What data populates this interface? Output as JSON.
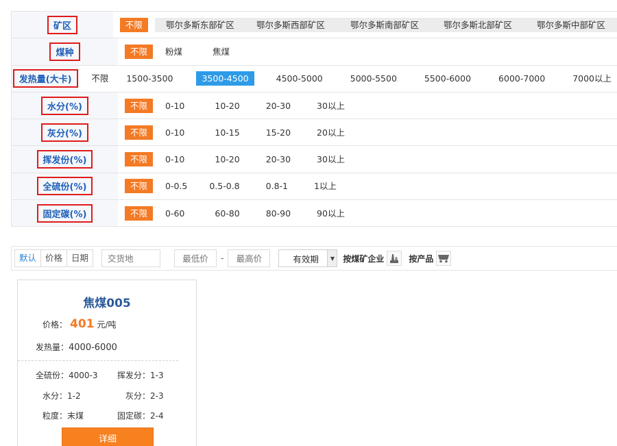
{
  "filters": [
    {
      "label": "矿区",
      "all": "不限",
      "options": [
        "鄂尔多斯东部矿区",
        "鄂尔多斯西部矿区",
        "鄂尔多斯南部矿区",
        "鄂尔多斯北部矿区",
        "鄂尔多斯中部矿区"
      ]
    },
    {
      "label": "煤种",
      "all": "不限",
      "options": [
        "粉煤",
        "焦煤"
      ]
    },
    {
      "label": "发热量(大卡)",
      "all": "不限",
      "options": [
        "1500-3500",
        "3500-4500",
        "4500-5000",
        "5000-5500",
        "5500-6000",
        "6000-7000",
        "7000以上"
      ],
      "selected": "3500-4500"
    },
    {
      "label": "水分(%)",
      "all": "不限",
      "options": [
        "0-10",
        "10-20",
        "20-30",
        "30以上"
      ]
    },
    {
      "label": "灰分(%)",
      "all": "不限",
      "options": [
        "0-10",
        "10-15",
        "15-20",
        "20以上"
      ]
    },
    {
      "label": "挥发份(%)",
      "all": "不限",
      "options": [
        "0-10",
        "10-20",
        "20-30",
        "30以上"
      ]
    },
    {
      "label": "全硫份(%)",
      "all": "不限",
      "options": [
        "0-0.5",
        "0.5-0.8",
        "0.8-1",
        "1以上"
      ]
    },
    {
      "label": "固定碳(%)",
      "all": "不限",
      "options": [
        "0-60",
        "60-80",
        "80-90",
        "90以上"
      ]
    }
  ],
  "toolbar": {
    "sort": [
      "默认",
      "价格",
      "日期"
    ],
    "place_placeholder": "交货地",
    "min_placeholder": "最低价",
    "dash": "-",
    "max_placeholder": "最高价",
    "validity": "有效期",
    "by_company": "按煤矿企业",
    "by_product": "按产品"
  },
  "card": {
    "title": "焦煤005",
    "price_label": "价格：",
    "price": "401",
    "price_unit": "元/吨",
    "calorific_label": "发热量：",
    "calorific": "4000-6000",
    "sulfur_label": "全硫份：",
    "sulfur": "4000-3",
    "volatile_label": "挥发分：",
    "volatile": "1-3",
    "moisture_label": "水分：",
    "moisture": "1-2",
    "ash_label": "灰分：",
    "ash": "2-3",
    "size_label": "粒度：",
    "size": "末煤",
    "carbon_label": "固定碳：",
    "carbon": "2-4",
    "detail": "详细"
  },
  "colors": {
    "accent": "#f47a24",
    "selected": "#2e9be8",
    "label": "#1e5fb8",
    "highlight_box": "#e11a1a"
  }
}
